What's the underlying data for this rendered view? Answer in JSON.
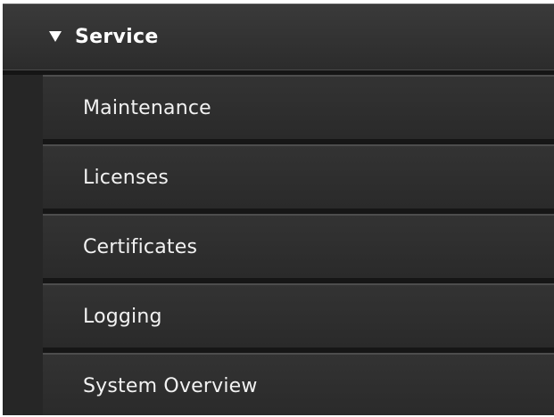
{
  "section": {
    "title": "Service",
    "expanded": true,
    "caret_icon": "caret-down-icon"
  },
  "items": [
    {
      "label": "Maintenance"
    },
    {
      "label": "Licenses"
    },
    {
      "label": "Certificates"
    },
    {
      "label": "Logging"
    },
    {
      "label": "System Overview"
    }
  ],
  "colors": {
    "panel_background": "#1f1f1f",
    "item_background": "#303030",
    "text": "#f2f2f2"
  }
}
